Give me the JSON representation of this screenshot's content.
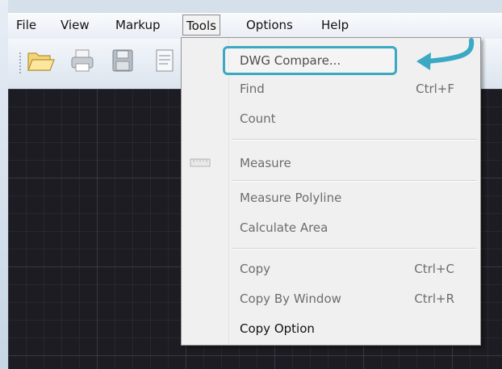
{
  "menubar": {
    "items": [
      {
        "label": "File"
      },
      {
        "label": "View"
      },
      {
        "label": "Markup"
      },
      {
        "label": "Tools"
      },
      {
        "label": "Options"
      },
      {
        "label": "Help"
      }
    ],
    "open_menu": "Tools"
  },
  "toolbar": {
    "buttons": [
      {
        "icon": "folder-open-icon"
      },
      {
        "icon": "printer-icon"
      },
      {
        "icon": "save-icon"
      },
      {
        "icon": "document-icon"
      }
    ]
  },
  "tools_menu": {
    "items": [
      {
        "label": "DWG Compare...",
        "shortcut": "",
        "state": "enabled",
        "highlighted": true
      },
      {
        "label": "Find",
        "shortcut": "Ctrl+F",
        "state": "disabled"
      },
      {
        "label": "Count",
        "shortcut": "",
        "state": "disabled"
      },
      {
        "label": "Measure",
        "shortcut": "",
        "state": "disabled",
        "icon": "ruler-icon"
      },
      {
        "label": "Measure Polyline",
        "shortcut": "",
        "state": "disabled"
      },
      {
        "label": "Calculate Area",
        "shortcut": "",
        "state": "disabled"
      },
      {
        "label": "Copy",
        "shortcut": "Ctrl+C",
        "state": "disabled"
      },
      {
        "label": "Copy By Window",
        "shortcut": "Ctrl+R",
        "state": "disabled"
      },
      {
        "label": "Copy Option",
        "shortcut": "",
        "state": "enabled"
      }
    ]
  },
  "annotation": {
    "highlight_color": "#3ba8c4",
    "arrow_icon": "curved-arrow-icon"
  },
  "colors": {
    "canvas_background": "#1c1c22",
    "menu_background": "#f0f0f0",
    "disabled_text": "#6d6d6d"
  }
}
